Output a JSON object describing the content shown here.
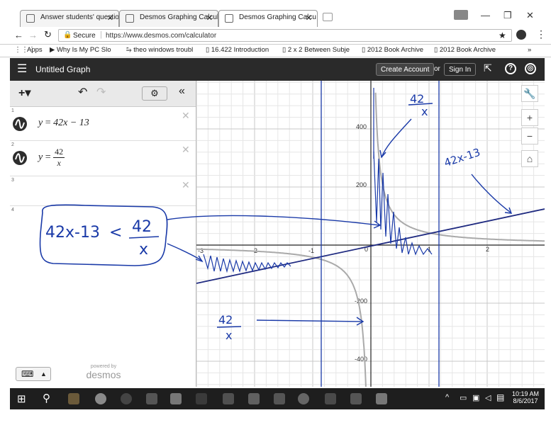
{
  "browser": {
    "tabs": [
      {
        "title": "Answer students' questio",
        "active": false
      },
      {
        "title": "Desmos Graphing Calcul",
        "active": false
      },
      {
        "title": "Desmos Graphing Calcu",
        "active": true
      }
    ],
    "secure_label": "Secure",
    "url": "https://www.desmos.com/calculator",
    "bookmarks": [
      "Apps",
      "Why Is My PC Slo",
      "theo windows troubl",
      "16.422 Introduction",
      "2 x 2 Between Subje",
      "2012 Book Archive",
      "2012 Book Archive"
    ],
    "bookmarks_more": "»"
  },
  "header": {
    "title": "Untitled Graph",
    "create_account": "Create Account",
    "or_label": "or",
    "sign_in": "Sign In",
    "bg_color": "#2a2a2a"
  },
  "expressions": [
    {
      "num": "1",
      "lhs": "y",
      "eq": "=",
      "rhs": "42x − 13",
      "type": "linear"
    },
    {
      "num": "2",
      "lhs": "y",
      "eq": "=",
      "num_part": "42",
      "den_part": "x",
      "type": "fraction"
    },
    {
      "num": "3"
    },
    {
      "num": "4"
    }
  ],
  "graph": {
    "x_ticks": [
      "-3",
      "-2",
      "-1",
      "0",
      "1",
      "2"
    ],
    "y_ticks": [
      "400",
      "200",
      "-200",
      "-400"
    ],
    "curve_color": "#aaaaaa",
    "line_color": "#1f2a80",
    "ink_color": "#1a3aa8"
  },
  "annotations": {
    "box_text_lhs": "42x-13",
    "box_text_op": "<",
    "box_num": "42",
    "box_den": "x",
    "top_num": "42",
    "top_den": "x",
    "line_label": "42x-13",
    "bottom_num": "42",
    "bottom_den": "x"
  },
  "footer": {
    "powered_by": "powered by",
    "brand": "desmos"
  },
  "taskbar": {
    "time": "10:19 AM",
    "date": "8/6/2017"
  }
}
